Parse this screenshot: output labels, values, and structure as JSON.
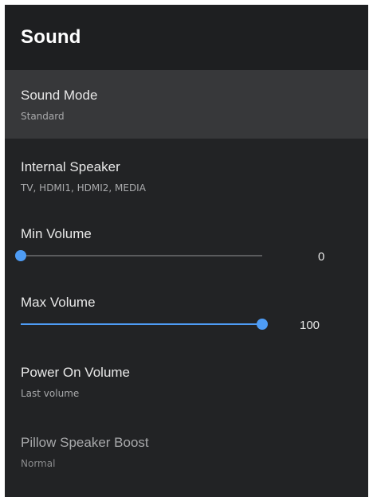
{
  "header": {
    "title": "Sound"
  },
  "items": {
    "sound_mode": {
      "title": "Sound Mode",
      "subtitle": "Standard"
    },
    "internal_speaker": {
      "title": "Internal Speaker",
      "subtitle": "TV, HDMI1, HDMI2, MEDIA"
    },
    "min_volume": {
      "title": "Min Volume",
      "value": 0,
      "value_text": "0",
      "min": 0,
      "max": 100
    },
    "max_volume": {
      "title": "Max Volume",
      "value": 100,
      "value_text": "100",
      "min": 0,
      "max": 100
    },
    "power_on_volume": {
      "title": "Power On Volume",
      "subtitle": "Last volume"
    },
    "pillow_speaker_boost": {
      "title": "Pillow Speaker Boost",
      "subtitle": "Normal"
    }
  },
  "colors": {
    "background": "#222325",
    "header_background": "#1e1f21",
    "selected_row": "#37383a",
    "accent": "#4e9cf5",
    "track": "#5a5b5d"
  }
}
